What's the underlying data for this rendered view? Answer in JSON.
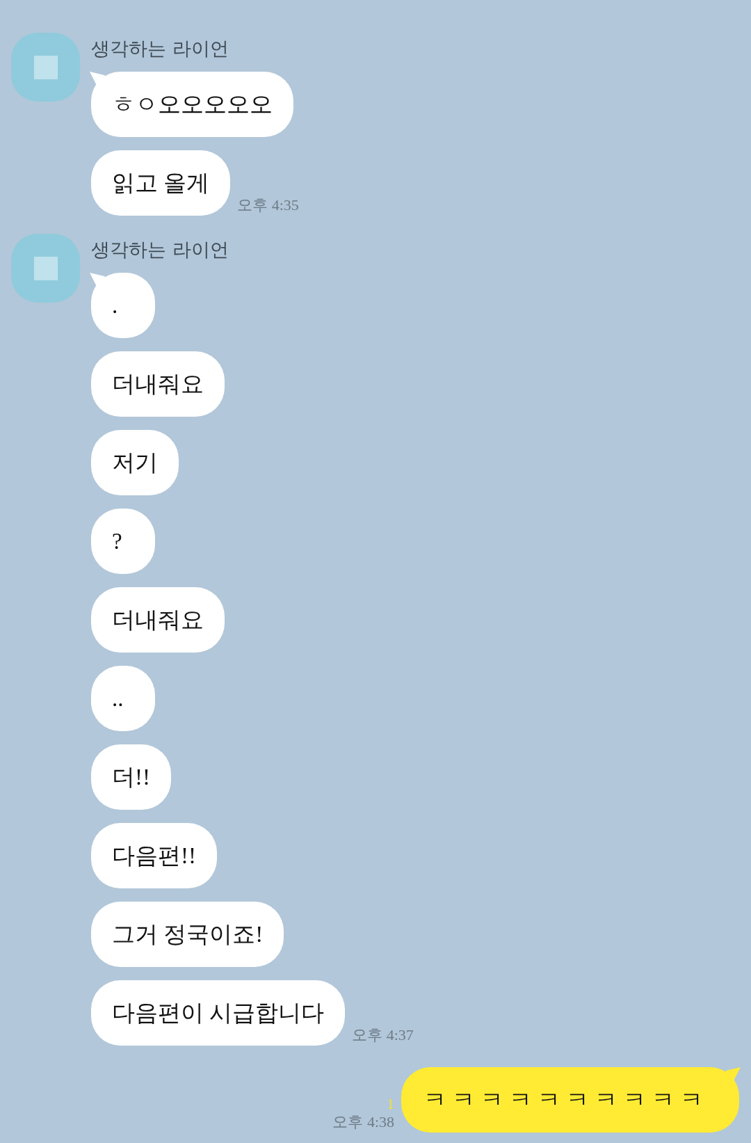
{
  "groups": [
    {
      "sender": "생각하는 라이언",
      "time": "오후 4:35",
      "messages": [
        {
          "text": "ㅎㅇ오오오오오"
        },
        {
          "text": "읽고 올게"
        }
      ]
    },
    {
      "sender": "생각하는 라이언",
      "time": "오후 4:37",
      "messages": [
        {
          "text": "."
        },
        {
          "text": "더내줘요"
        },
        {
          "text": "저기"
        },
        {
          "text": "?"
        },
        {
          "text": "더내줘요"
        },
        {
          "text": ".."
        },
        {
          "text": "더!!"
        },
        {
          "text": "다음편!!"
        },
        {
          "text": "그거 정국이죠!"
        },
        {
          "text": "다음편이 시급합니다"
        }
      ]
    }
  ],
  "my_messages": [
    {
      "text": "ㅋㅋㅋㅋㅋㅋㅋㅋㅋㅋ",
      "unread": "1",
      "time": "오후 4:38"
    }
  ]
}
